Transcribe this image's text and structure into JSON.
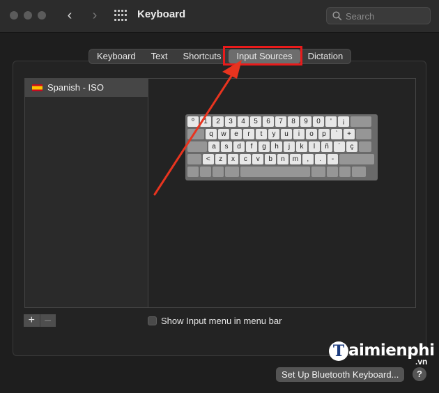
{
  "window": {
    "title": "Keyboard",
    "search_placeholder": "Search",
    "back_icon": "chevron-left-icon",
    "forward_icon": "chevron-right-icon",
    "grid_icon": "show-all-grid-icon"
  },
  "tabs": [
    {
      "label": "Keyboard",
      "selected": false
    },
    {
      "label": "Text",
      "selected": false
    },
    {
      "label": "Shortcuts",
      "selected": false
    },
    {
      "label": "Input Sources",
      "selected": true
    },
    {
      "label": "Dictation",
      "selected": false
    }
  ],
  "input_sources": [
    {
      "label": "Spanish - ISO",
      "flag": "spain-flag-icon"
    }
  ],
  "keyboard_layout": {
    "rows": [
      [
        "º",
        "1",
        "2",
        "3",
        "4",
        "5",
        "6",
        "7",
        "8",
        "9",
        "0",
        "'",
        "¡"
      ],
      [
        "q",
        "w",
        "e",
        "r",
        "t",
        "y",
        "u",
        "i",
        "o",
        "p",
        "`",
        "+"
      ],
      [
        "a",
        "s",
        "d",
        "f",
        "g",
        "h",
        "j",
        "k",
        "l",
        "ñ",
        "´",
        "ç"
      ],
      [
        "<",
        "z",
        "x",
        "c",
        "v",
        "b",
        "n",
        "m",
        ",",
        ".",
        "-"
      ]
    ]
  },
  "controls": {
    "add_label": "+",
    "remove_label": "–",
    "show_input_menu_label": "Show Input menu in menu bar",
    "show_input_menu_checked": false,
    "bluetooth_button_label": "Set Up Bluetooth Keyboard...",
    "help_label": "?"
  },
  "watermark": {
    "logo_letter": "T",
    "text": "aimienphi",
    "suffix": ".vn"
  },
  "colors": {
    "highlight": "#e81b1b",
    "arrow": "#e8341f"
  }
}
